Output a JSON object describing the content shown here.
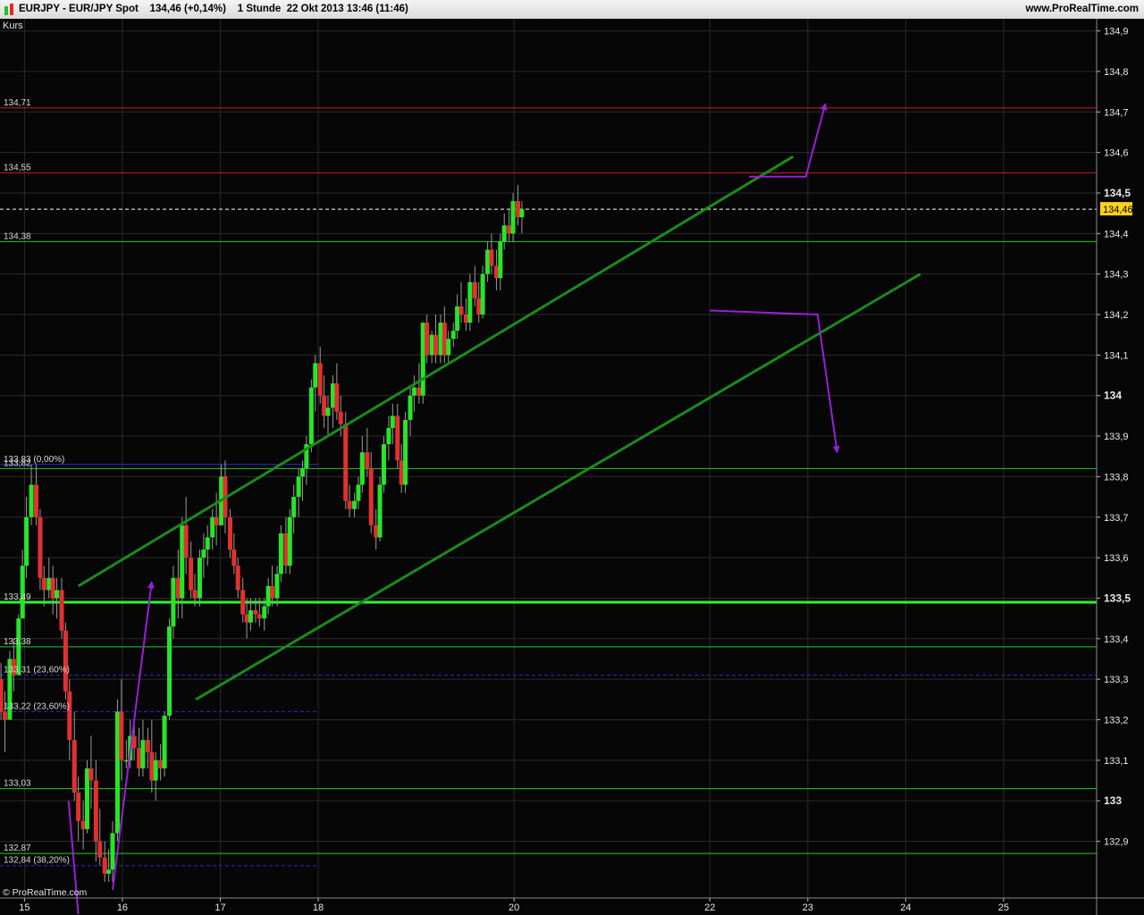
{
  "header": {
    "symbol": "EURJPY",
    "instrument": "EUR/JPY Spot",
    "last_price": "134,46",
    "change": "(+0,14%)",
    "timeframe": "1 Stunde",
    "datetime": "22 Okt 2013 13:46 (11:46)",
    "brand": "www.ProRealTime.com"
  },
  "panel_label": "Kurs",
  "copyright": "© ProRealTime.com",
  "chart_data": {
    "type": "candlestick",
    "y_range": [
      132.76,
      134.93
    ],
    "x_range": [
      14.75,
      25.95
    ],
    "y_ticks": [
      {
        "value": 134.9,
        "label": "134,9",
        "bold": false
      },
      {
        "value": 134.8,
        "label": "134,8",
        "bold": false
      },
      {
        "value": 134.7,
        "label": "134,7",
        "bold": false
      },
      {
        "value": 134.6,
        "label": "134,6",
        "bold": false
      },
      {
        "value": 134.5,
        "label": "134,5",
        "bold": true
      },
      {
        "value": 134.4,
        "label": "134,4",
        "bold": false
      },
      {
        "value": 134.3,
        "label": "134,3",
        "bold": false
      },
      {
        "value": 134.2,
        "label": "134,2",
        "bold": false
      },
      {
        "value": 134.1,
        "label": "134,1",
        "bold": false
      },
      {
        "value": 134.0,
        "label": "134",
        "bold": true
      },
      {
        "value": 133.9,
        "label": "133,9",
        "bold": false
      },
      {
        "value": 133.8,
        "label": "133,8",
        "bold": false
      },
      {
        "value": 133.7,
        "label": "133,7",
        "bold": false
      },
      {
        "value": 133.6,
        "label": "133,6",
        "bold": false
      },
      {
        "value": 133.5,
        "label": "133,5",
        "bold": true
      },
      {
        "value": 133.4,
        "label": "133,4",
        "bold": false
      },
      {
        "value": 133.3,
        "label": "133,3",
        "bold": false
      },
      {
        "value": 133.2,
        "label": "133,2",
        "bold": false
      },
      {
        "value": 133.1,
        "label": "133,1",
        "bold": false
      },
      {
        "value": 133.0,
        "label": "133",
        "bold": true
      },
      {
        "value": 132.9,
        "label": "132,9",
        "bold": false
      }
    ],
    "x_ticks": [
      {
        "value": 15,
        "label": "15"
      },
      {
        "value": 16,
        "label": "16"
      },
      {
        "value": 17,
        "label": "17"
      },
      {
        "value": 18,
        "label": "18"
      },
      {
        "value": 20,
        "label": "20"
      },
      {
        "value": 22,
        "label": "22"
      },
      {
        "value": 23,
        "label": "23"
      },
      {
        "value": 24,
        "label": "24"
      },
      {
        "value": 25,
        "label": "25"
      }
    ],
    "grid": true,
    "current_price": {
      "value": 134.46,
      "label": "134,46",
      "color": "#ffd21c"
    },
    "levels": [
      {
        "value": 134.71,
        "label": "134,71",
        "color": "#d41a1a",
        "width": 1
      },
      {
        "value": 134.55,
        "label": "134,55",
        "color": "#d41a1a",
        "width": 1
      },
      {
        "value": 134.38,
        "label": "134,38",
        "color": "#27c927",
        "width": 1
      },
      {
        "value": 133.82,
        "label": "133,82",
        "color": "#27c927",
        "width": 1
      },
      {
        "value": 133.49,
        "label": "133,49",
        "color": "#2df22d",
        "width": 3
      },
      {
        "value": 133.38,
        "label": "133,38",
        "color": "#27c927",
        "width": 1
      },
      {
        "value": 133.03,
        "label": "133,03",
        "color": "#27c927",
        "width": 1
      },
      {
        "value": 132.87,
        "label": "132,87",
        "color": "#27c927",
        "width": 1
      }
    ],
    "fib_levels": [
      {
        "value": 133.83,
        "label": "133,83 (0,00%)",
        "x_end": 18.0,
        "color": "#2a2ad6",
        "dashed": false
      },
      {
        "value": 133.31,
        "label": "133,31 (23,60%)",
        "x_end": 25.95,
        "color": "#2a2ad6",
        "dashed": true
      },
      {
        "value": 133.22,
        "label": "133,22 (23,60%)",
        "x_end": 18.0,
        "color": "#2a2ad6",
        "dashed": true
      },
      {
        "value": 132.84,
        "label": "132,84 (38,20%)",
        "x_end": 18.0,
        "color": "#2a2ad6",
        "dashed": true
      }
    ],
    "channel_lines": [
      {
        "x1": 15.55,
        "y1": 133.53,
        "x2": 22.85,
        "y2": 134.59
      },
      {
        "x1": 16.75,
        "y1": 133.25,
        "x2": 24.15,
        "y2": 134.3
      }
    ],
    "annotations": [
      {
        "points": [
          [
            15.45,
            133.0
          ],
          [
            15.55,
            132.72
          ]
        ],
        "arrow": false
      },
      {
        "points": [
          [
            15.9,
            132.78
          ],
          [
            16.3,
            133.54
          ]
        ],
        "arrow": true
      },
      {
        "points": [
          [
            22.4,
            134.54
          ],
          [
            22.98,
            134.54
          ],
          [
            23.18,
            134.72
          ]
        ],
        "arrow": true
      },
      {
        "points": [
          [
            22.0,
            134.21
          ],
          [
            23.1,
            134.2
          ],
          [
            23.3,
            133.86
          ]
        ],
        "arrow": true
      }
    ],
    "candles": [
      [
        14.76,
        133.3,
        133.34,
        133.2,
        133.22
      ],
      [
        14.8,
        133.22,
        133.27,
        133.12,
        133.2
      ],
      [
        14.85,
        133.2,
        133.37,
        133.2,
        133.35
      ],
      [
        14.89,
        133.35,
        133.4,
        133.27,
        133.31
      ],
      [
        14.94,
        133.31,
        133.46,
        133.31,
        133.45
      ],
      [
        14.98,
        133.45,
        133.62,
        133.45,
        133.58
      ],
      [
        15.02,
        133.58,
        133.75,
        133.55,
        133.7
      ],
      [
        15.07,
        133.7,
        133.83,
        133.68,
        133.78
      ],
      [
        15.12,
        133.78,
        133.83,
        133.68,
        133.7
      ],
      [
        15.16,
        133.7,
        133.72,
        133.52,
        133.55
      ],
      [
        15.2,
        133.55,
        133.58,
        133.48,
        133.52
      ],
      [
        15.25,
        133.52,
        133.6,
        133.5,
        133.55
      ],
      [
        15.29,
        133.55,
        133.58,
        133.46,
        133.5
      ],
      [
        15.33,
        133.5,
        133.55,
        133.45,
        133.52
      ],
      [
        15.38,
        133.52,
        133.55,
        133.4,
        133.42
      ],
      [
        15.42,
        133.42,
        133.44,
        133.25,
        133.27
      ],
      [
        15.46,
        133.27,
        133.3,
        133.1,
        133.15
      ],
      [
        15.51,
        133.15,
        133.22,
        133.0,
        133.02
      ],
      [
        15.55,
        133.02,
        133.06,
        132.9,
        132.95
      ],
      [
        15.6,
        132.95,
        133.0,
        132.88,
        132.93
      ],
      [
        15.64,
        132.93,
        133.1,
        132.92,
        133.08
      ],
      [
        15.68,
        133.08,
        133.16,
        132.98,
        133.05
      ],
      [
        15.73,
        133.05,
        133.1,
        132.85,
        132.9
      ],
      [
        15.77,
        132.9,
        132.98,
        132.84,
        132.86
      ],
      [
        15.82,
        132.86,
        132.9,
        132.8,
        132.82
      ],
      [
        15.86,
        132.82,
        132.88,
        132.8,
        132.83
      ],
      [
        15.9,
        132.83,
        132.95,
        132.8,
        132.92
      ],
      [
        15.95,
        132.92,
        133.25,
        132.9,
        133.22
      ],
      [
        15.99,
        133.22,
        133.3,
        133.05,
        133.1
      ],
      [
        16.04,
        133.1,
        133.15,
        133.08,
        133.1
      ],
      [
        16.08,
        133.1,
        133.2,
        133.08,
        133.16
      ],
      [
        16.12,
        133.16,
        133.2,
        133.1,
        133.13
      ],
      [
        16.17,
        133.13,
        133.18,
        133.06,
        133.08
      ],
      [
        16.21,
        133.08,
        133.2,
        133.06,
        133.15
      ],
      [
        16.26,
        133.15,
        133.18,
        133.08,
        133.12
      ],
      [
        16.3,
        133.12,
        133.2,
        133.02,
        133.05
      ],
      [
        16.34,
        133.05,
        133.12,
        133.0,
        133.1
      ],
      [
        16.39,
        133.1,
        133.14,
        133.05,
        133.08
      ],
      [
        16.43,
        133.08,
        133.22,
        133.06,
        133.21
      ],
      [
        16.48,
        133.21,
        133.45,
        133.2,
        133.43
      ],
      [
        16.52,
        133.43,
        133.58,
        133.4,
        133.55
      ],
      [
        16.57,
        133.55,
        133.62,
        133.45,
        133.5
      ],
      [
        16.61,
        133.5,
        133.7,
        133.45,
        133.68
      ],
      [
        16.65,
        133.68,
        133.75,
        133.56,
        133.6
      ],
      [
        16.7,
        133.6,
        133.64,
        133.5,
        133.52
      ],
      [
        16.74,
        133.52,
        133.56,
        133.48,
        133.5
      ],
      [
        16.79,
        133.5,
        133.62,
        133.48,
        133.6
      ],
      [
        16.83,
        133.6,
        133.66,
        133.55,
        133.62
      ],
      [
        16.87,
        133.62,
        133.68,
        133.58,
        133.65
      ],
      [
        16.92,
        133.65,
        133.72,
        133.62,
        133.7
      ],
      [
        16.96,
        133.7,
        133.76,
        133.63,
        133.68
      ],
      [
        17.01,
        133.68,
        133.83,
        133.68,
        133.8
      ],
      [
        17.05,
        133.8,
        133.84,
        133.66,
        133.7
      ],
      [
        17.1,
        133.7,
        133.72,
        133.6,
        133.62
      ],
      [
        17.14,
        133.62,
        133.66,
        133.56,
        133.58
      ],
      [
        17.18,
        133.58,
        133.6,
        133.5,
        133.52
      ],
      [
        17.23,
        133.52,
        133.55,
        133.44,
        133.46
      ],
      [
        17.27,
        133.46,
        133.5,
        133.4,
        133.44
      ],
      [
        17.31,
        133.44,
        133.5,
        133.42,
        133.47
      ],
      [
        17.36,
        133.47,
        133.5,
        133.44,
        133.46
      ],
      [
        17.4,
        133.46,
        133.5,
        133.43,
        133.45
      ],
      [
        17.45,
        133.45,
        133.5,
        133.42,
        133.48
      ],
      [
        17.49,
        133.48,
        133.55,
        133.46,
        133.53
      ],
      [
        17.53,
        133.53,
        133.58,
        133.48,
        133.5
      ],
      [
        17.58,
        133.5,
        133.58,
        133.48,
        133.56
      ],
      [
        17.62,
        133.56,
        133.68,
        133.54,
        133.66
      ],
      [
        17.67,
        133.66,
        133.7,
        133.56,
        133.58
      ],
      [
        17.71,
        133.58,
        133.72,
        133.56,
        133.7
      ],
      [
        17.75,
        133.7,
        133.78,
        133.66,
        133.75
      ],
      [
        17.8,
        133.75,
        133.82,
        133.7,
        133.8
      ],
      [
        17.84,
        133.8,
        133.84,
        133.74,
        133.82
      ],
      [
        17.88,
        133.82,
        133.9,
        133.78,
        133.88
      ],
      [
        17.93,
        133.88,
        134.04,
        133.86,
        134.02
      ],
      [
        17.97,
        134.02,
        134.1,
        133.96,
        134.08
      ],
      [
        18.02,
        134.08,
        134.12,
        133.98,
        134.0
      ],
      [
        18.06,
        134.0,
        134.05,
        133.92,
        133.95
      ],
      [
        18.1,
        133.95,
        134.0,
        133.9,
        133.97
      ],
      [
        18.15,
        133.97,
        134.05,
        133.92,
        134.03
      ],
      [
        18.19,
        134.03,
        134.08,
        133.94,
        133.96
      ],
      [
        18.23,
        133.96,
        134.0,
        133.9,
        133.93
      ],
      [
        18.28,
        133.93,
        133.96,
        133.72,
        133.74
      ],
      [
        18.32,
        133.74,
        133.78,
        133.7,
        133.72
      ],
      [
        18.37,
        133.72,
        133.76,
        133.7,
        133.74
      ],
      [
        18.41,
        133.74,
        133.8,
        133.72,
        133.78
      ],
      [
        18.45,
        133.78,
        133.9,
        133.76,
        133.86
      ],
      [
        18.5,
        133.86,
        133.92,
        133.8,
        133.82
      ],
      [
        18.54,
        133.82,
        133.86,
        133.66,
        133.68
      ],
      [
        18.59,
        133.68,
        133.72,
        133.62,
        133.65
      ],
      [
        18.63,
        133.65,
        133.8,
        133.64,
        133.78
      ],
      [
        18.67,
        133.78,
        133.9,
        133.76,
        133.88
      ],
      [
        18.72,
        133.88,
        133.95,
        133.84,
        133.92
      ],
      [
        18.76,
        133.92,
        133.98,
        133.88,
        133.95
      ],
      [
        18.81,
        133.95,
        133.98,
        133.82,
        133.84
      ],
      [
        18.85,
        133.84,
        133.88,
        133.76,
        133.78
      ],
      [
        18.89,
        133.78,
        133.96,
        133.76,
        133.94
      ],
      [
        18.94,
        133.94,
        134.02,
        133.9,
        134.0
      ],
      [
        18.98,
        134.0,
        134.05,
        133.96,
        134.02
      ],
      [
        19.03,
        134.02,
        134.08,
        133.98,
        134.0
      ],
      [
        19.07,
        134.0,
        134.18,
        133.98,
        134.18
      ],
      [
        19.11,
        134.18,
        134.2,
        134.08,
        134.1
      ],
      [
        19.16,
        134.1,
        134.16,
        134.08,
        134.15
      ],
      [
        19.2,
        134.15,
        134.2,
        134.08,
        134.1
      ],
      [
        19.25,
        134.1,
        134.2,
        134.08,
        134.18
      ],
      [
        19.29,
        134.18,
        134.22,
        134.08,
        134.1
      ],
      [
        19.33,
        134.1,
        134.16,
        134.08,
        134.14
      ],
      [
        19.38,
        134.14,
        134.18,
        134.12,
        134.16
      ],
      [
        19.42,
        134.16,
        134.25,
        134.14,
        134.22
      ],
      [
        19.46,
        134.22,
        134.28,
        134.18,
        134.2
      ],
      [
        19.51,
        134.2,
        134.24,
        134.16,
        134.18
      ],
      [
        19.55,
        134.18,
        134.3,
        134.16,
        134.28
      ],
      [
        19.6,
        134.28,
        134.32,
        134.22,
        134.24
      ],
      [
        19.64,
        134.24,
        134.28,
        134.18,
        134.2
      ],
      [
        19.68,
        134.2,
        134.32,
        134.19,
        134.3
      ],
      [
        19.73,
        134.3,
        134.38,
        134.28,
        134.36
      ],
      [
        19.77,
        134.36,
        134.4,
        134.3,
        134.32
      ],
      [
        19.82,
        134.32,
        134.36,
        134.26,
        134.29
      ],
      [
        19.86,
        134.29,
        134.4,
        134.26,
        134.38
      ],
      [
        19.9,
        134.38,
        134.45,
        134.36,
        134.42
      ],
      [
        19.95,
        134.42,
        134.46,
        134.38,
        134.4
      ],
      [
        19.99,
        134.4,
        134.5,
        134.38,
        134.48
      ],
      [
        20.04,
        134.48,
        134.52,
        134.42,
        134.44
      ],
      [
        20.08,
        134.44,
        134.48,
        134.4,
        134.46
      ]
    ]
  }
}
